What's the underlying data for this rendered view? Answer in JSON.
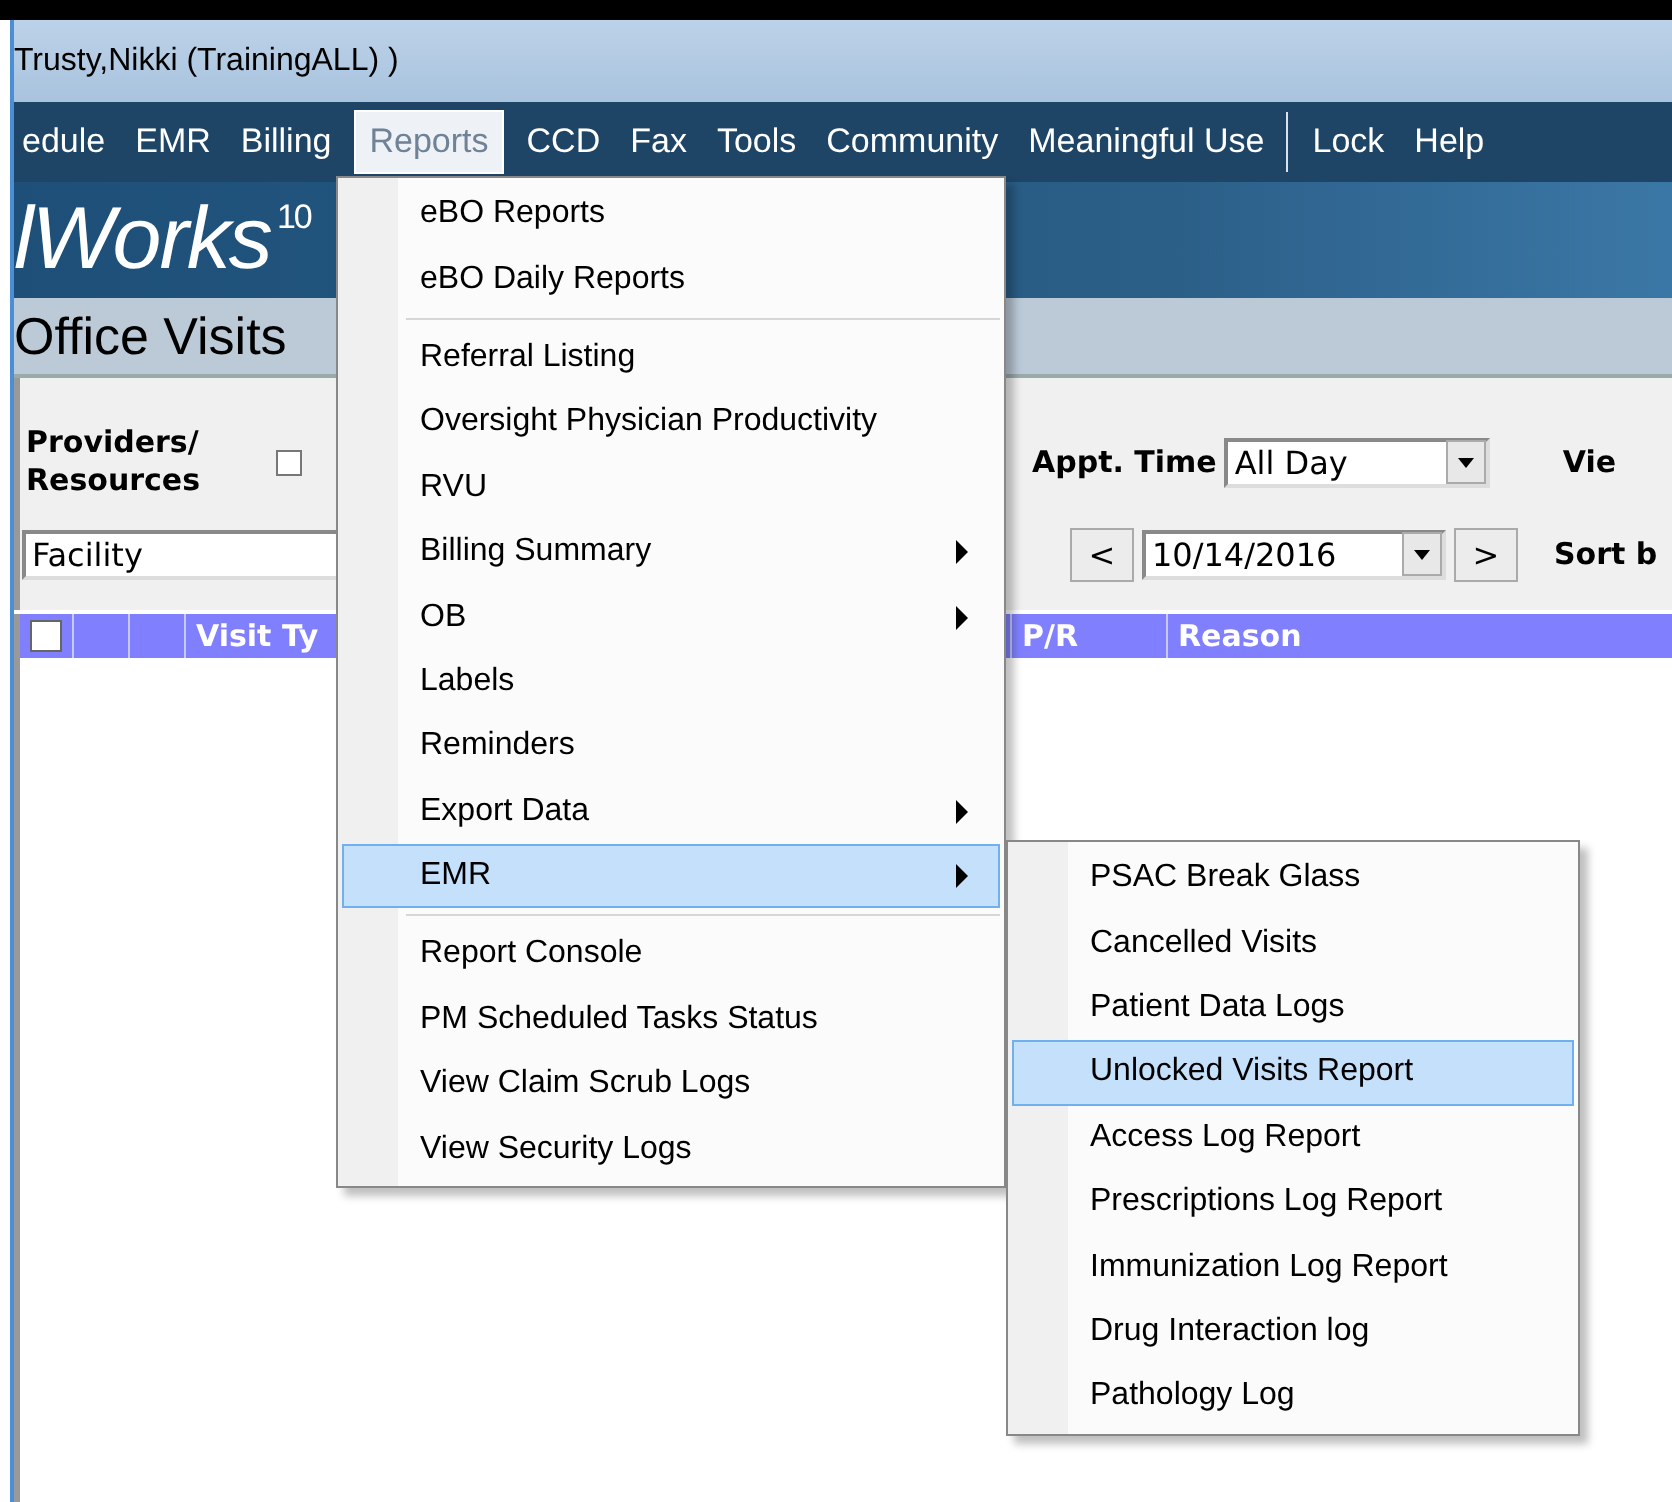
{
  "window": {
    "title": "Trusty,Nikki (TrainingALL) )"
  },
  "menu_bar": [
    {
      "kind": "item",
      "label": "edule",
      "selected": false
    },
    {
      "kind": "item",
      "label": "EMR",
      "selected": false
    },
    {
      "kind": "item",
      "label": "Billing",
      "selected": false
    },
    {
      "kind": "item",
      "label": "Reports",
      "selected": true
    },
    {
      "kind": "item",
      "label": "CCD",
      "selected": false
    },
    {
      "kind": "item",
      "label": "Fax",
      "selected": false
    },
    {
      "kind": "item",
      "label": "Tools",
      "selected": false
    },
    {
      "kind": "item",
      "label": "Community",
      "selected": false
    },
    {
      "kind": "item",
      "label": "Meaningful Use",
      "selected": false
    },
    {
      "kind": "separator"
    },
    {
      "kind": "item",
      "label": "Lock",
      "selected": false
    },
    {
      "kind": "item",
      "label": "Help",
      "selected": false
    }
  ],
  "banner": {
    "logo": "lWorks$^{10}$"
  },
  "page_title": "Office Visits",
  "filters": {
    "providers_label": "Providers/ Resources",
    "all_checked": false,
    "facility": "Facility",
    "appt_time_label": "Appt. Time",
    "appt_time": "All Day",
    "view_label": "Vie",
    "prev": "<",
    "date": "10/14/2016",
    "next": ">",
    "sort_label": "Sort b"
  },
  "table": {
    "select_all_checked": false,
    "columns": [
      {
        "label": "Visit Ty"
      },
      {
        "label": "P/R"
      },
      {
        "label": "Reason"
      }
    ]
  },
  "reports_menu": [
    {
      "kind": "item",
      "label": "eBO Reports",
      "submenu": false,
      "selected": false
    },
    {
      "kind": "item",
      "label": "eBO Daily Reports",
      "submenu": false,
      "selected": false
    },
    {
      "kind": "separator"
    },
    {
      "kind": "item",
      "label": "Referral Listing",
      "submenu": false,
      "selected": false
    },
    {
      "kind": "item",
      "label": "Oversight Physician Productivity",
      "submenu": false,
      "selected": false
    },
    {
      "kind": "item",
      "label": "RVU",
      "submenu": false,
      "selected": false
    },
    {
      "kind": "item",
      "label": "Billing Summary",
      "submenu": true,
      "selected": false
    },
    {
      "kind": "item",
      "label": "OB",
      "submenu": true,
      "selected": false
    },
    {
      "kind": "item",
      "label": "Labels",
      "submenu": false,
      "selected": false
    },
    {
      "kind": "item",
      "label": "Reminders",
      "submenu": false,
      "selected": false
    },
    {
      "kind": "item",
      "label": "Export Data",
      "submenu": true,
      "selected": false
    },
    {
      "kind": "item",
      "label": "EMR",
      "submenu": true,
      "selected": true
    },
    {
      "kind": "separator"
    },
    {
      "kind": "item",
      "label": "Report Console",
      "submenu": false,
      "selected": false
    },
    {
      "kind": "item",
      "label": "PM Scheduled Tasks Status",
      "submenu": false,
      "selected": false
    },
    {
      "kind": "item",
      "label": "View Claim Scrub Logs",
      "submenu": false,
      "selected": false
    },
    {
      "kind": "item",
      "label": "View Security Logs",
      "submenu": false,
      "selected": false
    }
  ],
  "emr_submenu": [
    {
      "kind": "item",
      "label": "PSAC Break Glass",
      "submenu": false,
      "selected": false
    },
    {
      "kind": "item",
      "label": "Cancelled Visits",
      "submenu": false,
      "selected": false
    },
    {
      "kind": "item",
      "label": "Patient Data Logs",
      "submenu": false,
      "selected": false
    },
    {
      "kind": "item",
      "label": "Unlocked Visits Report",
      "submenu": false,
      "selected": true
    },
    {
      "kind": "item",
      "label": "Access Log Report",
      "submenu": false,
      "selected": false
    },
    {
      "kind": "item",
      "label": "Prescriptions Log Report",
      "submenu": false,
      "selected": false
    },
    {
      "kind": "item",
      "label": "Immunization Log Report",
      "submenu": false,
      "selected": false
    },
    {
      "kind": "item",
      "label": "Drug Interaction log",
      "submenu": false,
      "selected": false
    },
    {
      "kind": "item",
      "label": "Pathology Log",
      "submenu": false,
      "selected": false
    }
  ]
}
